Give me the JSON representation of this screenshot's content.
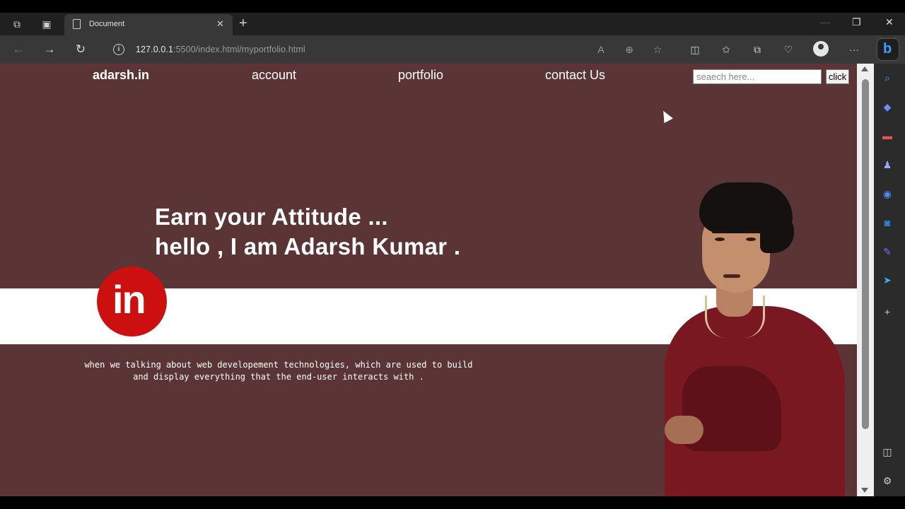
{
  "browser": {
    "tab_title": "Document",
    "tab_close": "✕",
    "new_tab": "+",
    "url_host": "127.0.0.1",
    "url_rest": ":5500/index.html/myportfolio.html",
    "window_controls": {
      "minimize": "—",
      "restore": "❐",
      "close": "✕"
    },
    "icons": {
      "back": "back-arrow-icon",
      "forward": "forward-arrow-icon",
      "refresh": "refresh-icon",
      "read_aloud": "read-aloud-icon",
      "zoom": "zoom-icon",
      "favorite": "star-icon",
      "split": "split-screen-icon",
      "favorites": "favorites-icon",
      "collections": "collections-icon",
      "performance": "performance-icon",
      "profile": "profile-icon",
      "menu": "more-icon",
      "bing": "bing-icon"
    }
  },
  "sidebar": {
    "items": [
      "search-icon",
      "shopping-icon",
      "tools-icon",
      "games-icon",
      "office-icon",
      "outlook-icon",
      "drop-icon",
      "telegram-icon",
      "add-icon",
      "sidebar-toggle-icon",
      "settings-icon"
    ]
  },
  "page": {
    "nav": {
      "brand": "adarsh.in",
      "account": "account",
      "portfolio": "portfolio",
      "contact": "contact Us"
    },
    "search": {
      "placeholder": "seaech here...",
      "button": "click"
    },
    "headline": {
      "line1": "Earn your Attitude ...",
      "line2": "hello , I am Adarsh Kumar ."
    },
    "linkedin_text": "in",
    "description": "when we talking about web developement technologies, which are used to build\nand display everything that the end-user interacts with ."
  },
  "colors": {
    "page_bg": "#5b3535",
    "linkedin_red": "#cc0f0f",
    "chrome_dark": "#202020",
    "chrome_mid": "#383838"
  }
}
